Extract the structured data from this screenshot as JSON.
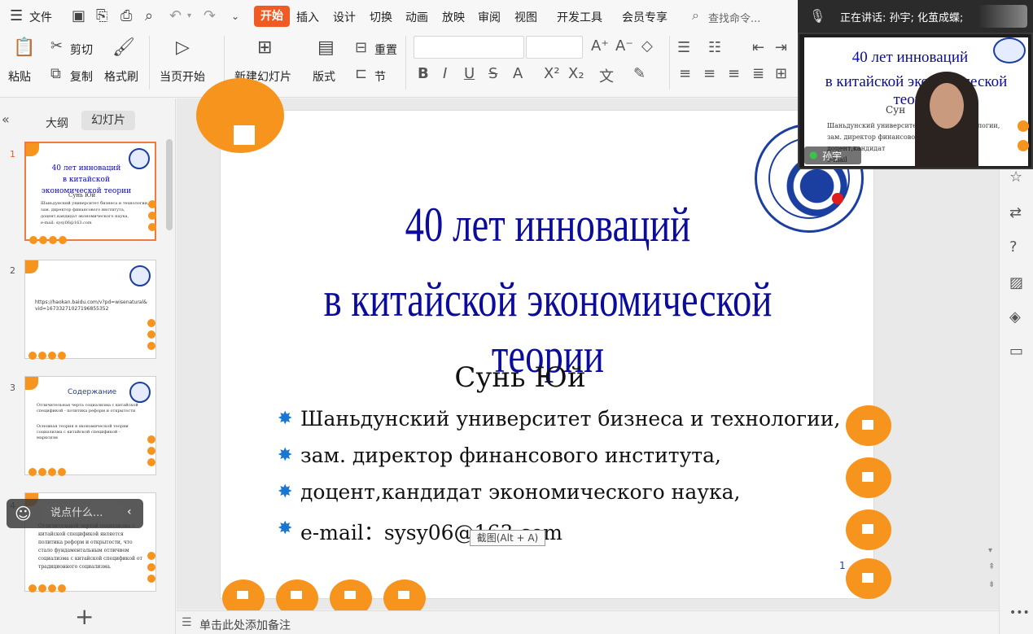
{
  "menu": {
    "file": "文件",
    "tabs": [
      "开始",
      "插入",
      "设计",
      "切换",
      "动画",
      "放映",
      "审阅",
      "视图",
      "开发工具",
      "会员专享"
    ],
    "search": "查找命令..."
  },
  "ribbon": {
    "paste": "粘贴",
    "cut": "剪切",
    "copy": "复制",
    "format_painter": "格式刷",
    "play_from_current": "当页开始",
    "new_slide": "新建幻灯片",
    "layout": "版式",
    "reset": "重置",
    "section": "节"
  },
  "panel": {
    "outline_tab": "大纲",
    "slides_tab": "幻灯片",
    "collapse": "«",
    "add": "+"
  },
  "thumbs": [
    {
      "num": "1",
      "title": "40 лет инноваций\nв китайской экономической теории",
      "sub": "Сунь Юй",
      "lines": [
        "Шаньдунский университет бизнеса и технологии,",
        "зам. директор финансового института,",
        "доцент,кандидат экономического наука,",
        "e-mail: sysy06@163.com"
      ]
    },
    {
      "num": "2",
      "lines": [
        "https://haokan.baidu.com/v?pd=wisenatural&vid=16733271027196855352"
      ]
    },
    {
      "num": "3",
      "title": "Содержание",
      "lines": [
        "Отличительная черта социализма с китайской спецификой - политика реформ и открытости",
        "Основная теория в экономической теории социализма с китайской спецификой - марксизм"
      ]
    },
    {
      "num": "4",
      "lines": [
        "Отличительной чертой социализма с китайской спецификой является политика реформ и открытости, что стало фундаментальным отличием социализма с китайской спецификой от традиционного социализма."
      ]
    }
  ],
  "slide": {
    "title_line1": "40 лет инноваций",
    "title_line2": "в китайской экономической теории",
    "author": "Сунь Юй",
    "bullets": [
      "Шаньдунский университет бизнеса и технологии,",
      "зам. директор финансового института,",
      "доцент,кандидат экономического наука,",
      "e-mail：sysy06@163.com"
    ],
    "page_number": "1"
  },
  "notes": {
    "placeholder": "单击此处添加备注"
  },
  "meeting": {
    "speaking": "正在讲话: 孙宇; 化茧成蝶;",
    "participant": "孙宇",
    "video_title1": "40 лет инноваций",
    "video_title2": "в китайской экономической теории",
    "video_author": "Сун",
    "video_lines": [
      "Шаньдунский университет бизнеса и технологии,",
      "зам. директор финансового института,",
      "доцент,кандидат",
      "e-mail"
    ]
  },
  "chat": {
    "placeholder": "说点什么..."
  },
  "tooltip": {
    "text": "截图(Alt + A)"
  },
  "colors": {
    "accent": "#f05b24",
    "title_blue": "#0b0b9c",
    "orange": "#f7941d",
    "bullet": "#1976d2"
  }
}
